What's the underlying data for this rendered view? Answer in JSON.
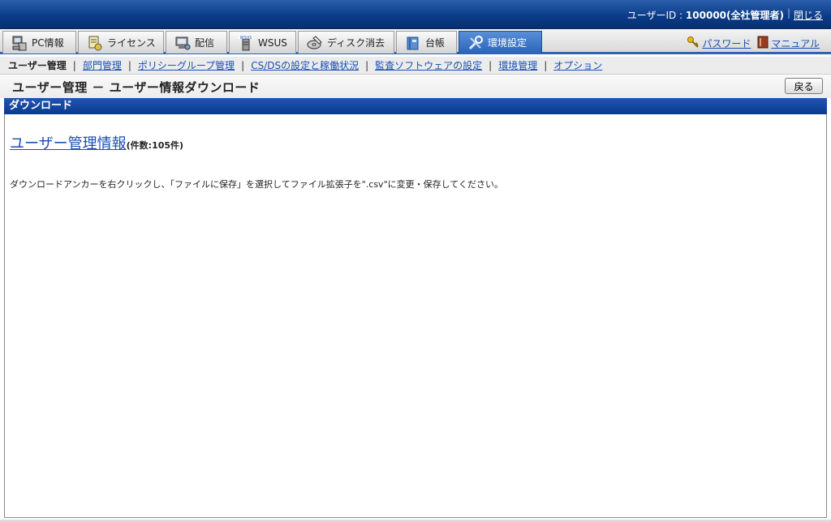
{
  "header": {
    "user_label": "ユーザーID : ",
    "user_value": "100000(全社管理者)",
    "close_label": "閉じる"
  },
  "tabs": [
    {
      "label": "PC情報",
      "icon": "pc-icon",
      "active": false
    },
    {
      "label": "ライセンス",
      "icon": "license-icon",
      "active": false
    },
    {
      "label": "配信",
      "icon": "delivery-icon",
      "active": false
    },
    {
      "label": "WSUS",
      "icon": "wsus-server-icon",
      "active": false
    },
    {
      "label": "ディスク消去",
      "icon": "disk-erase-icon",
      "active": false
    },
    {
      "label": "台帳",
      "icon": "ledger-icon",
      "active": false
    },
    {
      "label": "環境設定",
      "icon": "tools-icon",
      "active": true
    }
  ],
  "header_links": {
    "password": "パスワード",
    "manual": "マニュアル"
  },
  "subnav": {
    "current": "ユーザー管理",
    "links": [
      "部門管理",
      "ポリシーグループ管理",
      "CS/DSの設定と稼働状況",
      "監査ソフトウェアの設定",
      "環境管理",
      "オプション"
    ]
  },
  "page": {
    "title": "ユーザー管理 － ユーザー情報ダウンロード",
    "back_label": "戻る"
  },
  "section": {
    "header": "ダウンロード",
    "link_label": "ユーザー管理情報",
    "count_label": "(件数:105件)",
    "description": "ダウンロードアンカーを右クリックし、「ファイルに保存」を選択してファイル拡張子を\".csv\"に変更・保存してください。"
  },
  "colors": {
    "header_blue": "#0a3a86",
    "active_tab": "#2b64b8",
    "link": "#1a4fb3"
  }
}
